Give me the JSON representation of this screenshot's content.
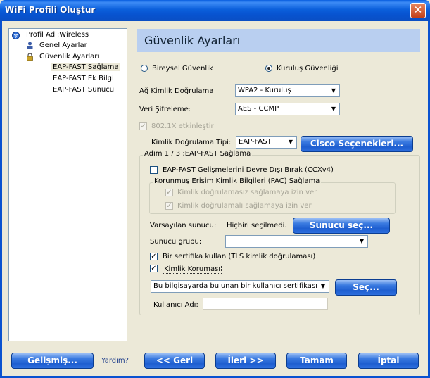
{
  "window": {
    "title": "WiFi Profili Oluştur",
    "close_glyph": "✕"
  },
  "tree": {
    "items": [
      {
        "label": "Profil Adı:Wireless",
        "icon": "wifi-icon"
      },
      {
        "label": "Genel Ayarlar",
        "icon": "user-icon"
      },
      {
        "label": "Güvenlik Ayarları",
        "icon": "lock-icon"
      },
      {
        "label": "EAP-FAST Sağlama",
        "selected": true
      },
      {
        "label": "EAP-FAST Ek Bilgi"
      },
      {
        "label": "EAP-FAST Sunucu"
      }
    ]
  },
  "header": {
    "title": "Güvenlik Ayarları"
  },
  "security_mode": {
    "personal_label": "Bireysel Güvenlik",
    "enterprise_label": "Kuruluş Güvenliği",
    "selected": "enterprise"
  },
  "network_auth": {
    "label": "Ağ Kimlik Doğrulama",
    "value": "WPA2 - Kuruluş"
  },
  "data_encryption": {
    "label": "Veri Şifreleme:",
    "value": "AES - CCMP"
  },
  "enable_8021x": {
    "label": "802.1X etkinleştir",
    "checked": true,
    "disabled": true
  },
  "auth_type": {
    "label": "Kimlik Doğrulama Tipi:",
    "value": "EAP-FAST"
  },
  "cisco_button": {
    "label": "Cisco Seçenekleri..."
  },
  "step_group": {
    "title": "Adım 1 / 3 :EAP-FAST Sağlama",
    "disable_enhancements": {
      "label": "EAP-FAST Gelişmelerini Devre Dışı Bırak (CCXv4)",
      "checked": false
    },
    "pac_group": {
      "title": "Korunmuş Erişim Kimlik Bilgileri (PAC) Sağlama",
      "unauth_label": "Kimlik doğrulamasız sağlamaya izin ver",
      "auth_label": "Kimlik doğrulamalı sağlamaya izin ver"
    },
    "default_server": {
      "label": "Varsayılan sunucu:",
      "value": "Hiçbiri seçilmedi."
    },
    "select_server_button": "Sunucu seç...",
    "server_group": {
      "label": "Sunucu grubu:",
      "value": ""
    },
    "use_cert": {
      "label": "Bir sertifika kullan (TLS kimlik doğrulaması)",
      "checked": true
    },
    "identity_protection": {
      "label": "Kimlik Koruması",
      "checked": true
    },
    "cert_combo": {
      "value": "Bu bilgisayarda bulunan bir kullanıcı sertifikasını k"
    },
    "select_button": "Seç...",
    "username": {
      "label": "Kullanıcı Adı:",
      "value": ""
    }
  },
  "footer": {
    "advanced_label": "Gelişmiş...",
    "help_label": "Yardım?",
    "back_label": "<< Geri",
    "next_label": "İleri >>",
    "ok_label": "Tamam",
    "cancel_label": "İptal"
  },
  "colors": {
    "titlebar": "#0A5FE0",
    "dialog_bg": "#ECE9D8",
    "header_panel": "#B9CFF0",
    "button_blue": "#1E5ED0",
    "close_red": "#C4411A"
  }
}
